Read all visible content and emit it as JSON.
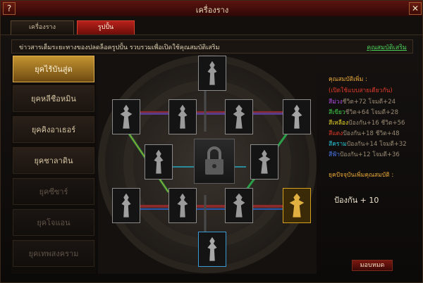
{
  "window": {
    "title": "เครื่องราง",
    "help_label": "?",
    "close_label": "✕"
  },
  "tabs": [
    {
      "label": "เครื่องราง",
      "active": false
    },
    {
      "label": "รูปปั้น",
      "active": true
    }
  ],
  "info": {
    "text": "ข่าวสารเต็มระยะทางของปลดล็อครูปปั้น รวบรวมเพื่อเปิดใช้คุณสมบัติเสริม",
    "link": "คุณสมบัติเสริม"
  },
  "eras": [
    {
      "label": "ยุคไร้บันสู่ด",
      "state": "active"
    },
    {
      "label": "ยุคหลีชือหมิน",
      "state": "normal"
    },
    {
      "label": "ยุคคิงอาเธอร์",
      "state": "normal"
    },
    {
      "label": "ยุคชาลาดิน",
      "state": "normal"
    },
    {
      "label": "ยุคซีซาร์",
      "state": "locked"
    },
    {
      "label": "ยุคโจแอน",
      "state": "locked"
    },
    {
      "label": "ยุคเทพสงคราม",
      "state": "locked"
    }
  ],
  "attributes": {
    "heading": "คุณสมบัติเพิ่ม :",
    "subheading": "(เปิดใช้แบบสายเดียวกัน)",
    "lines": [
      {
        "color_name": "สีม่วง",
        "color": "#b04ce0",
        "text": "ชีวิต+72 โจมตี+24"
      },
      {
        "color_name": "สีเขียว",
        "color": "#3fcf4a",
        "text": "ชีวิต+64 โจมตี+28"
      },
      {
        "color_name": "สีเหลือง",
        "color": "#e8d428",
        "text": "ป้องกัน+16 ชีวิต+56"
      },
      {
        "color_name": "สีแดง",
        "color": "#e23a2a",
        "text": "ป้องกัน+18 ชีวิต+48"
      },
      {
        "color_name": "สีคราม",
        "color": "#28c6d6",
        "text": "ป้องกัน+14 โจมตี+32"
      },
      {
        "color_name": "สีฟ้า",
        "color": "#4a7af0",
        "text": "ป้องกัน+12 โจมตี+36"
      }
    ],
    "era_bonus_heading": "ยุคปัจจุบันเพิ่มคุณสมบัติ :",
    "era_bonus_value": "ป้องกัน + 10"
  },
  "close_button_label": "มอบหมด",
  "colors": {
    "accent_red": "#b8201a",
    "gold": "#d6a21e",
    "selected_blue": "#3a9ad6"
  },
  "board_slots": [
    "top",
    "row1-1",
    "row1-2",
    "row1-3",
    "row1-4",
    "mid-left",
    "mid-right",
    "row3-1",
    "row3-2",
    "row3-3",
    "row3-4",
    "bottom"
  ],
  "center_icon": "lock-icon"
}
